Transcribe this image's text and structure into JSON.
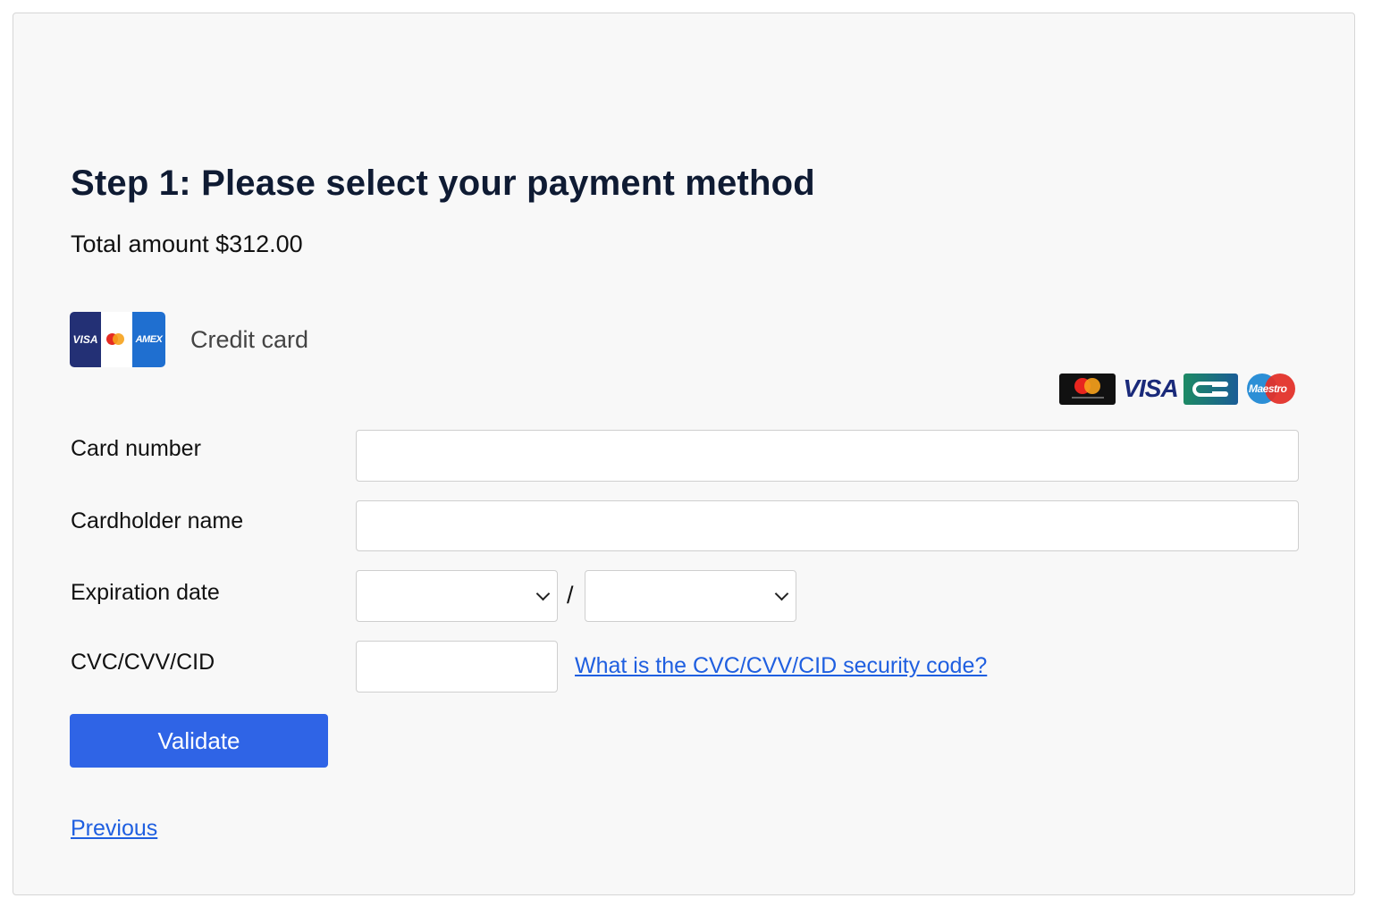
{
  "header": {
    "title": "Step 1: Please select your payment method",
    "total": "Total amount $312.00"
  },
  "payment_method": {
    "label": "Credit card",
    "logo_marks": [
      "VISA",
      "AMEX"
    ],
    "accepted_brands": [
      {
        "name": "Mastercard",
        "icon": "mastercard-icon"
      },
      {
        "name": "VISA",
        "icon": "visa-icon"
      },
      {
        "name": "CB",
        "icon": "cb-icon"
      },
      {
        "name": "Maestro",
        "icon": "maestro-icon"
      }
    ],
    "brand_text": {
      "visa": "VISA",
      "maestro": "Maestro"
    }
  },
  "form": {
    "card_number_label": "Card number",
    "card_number_value": "",
    "cardholder_label": "Cardholder name",
    "cardholder_value": "",
    "expiration_label": "Expiration date",
    "expiration_month_value": "",
    "expiration_year_value": "",
    "expiration_separator": "/",
    "cvc_label": "CVC/CVV/CID",
    "cvc_value": "",
    "cvc_help_link": "What is the CVC/CVV/CID security code?"
  },
  "actions": {
    "validate_label": "Validate",
    "previous_label": "Previous"
  },
  "colors": {
    "accent": "#2f64e6",
    "link": "#1f5fe0",
    "title": "#0f1b33",
    "background": "#f8f8f8"
  }
}
